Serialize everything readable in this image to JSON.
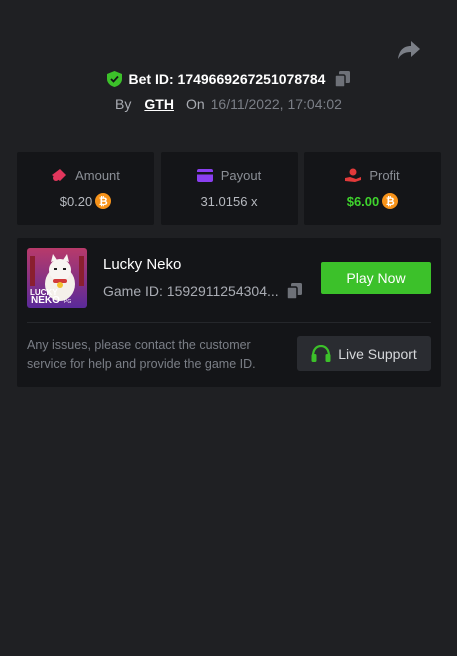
{
  "bet": {
    "id_label": "Bet ID: 1749669267251078784",
    "by_label": "By",
    "user": "GTH",
    "on_label": "On",
    "datetime": "16/11/2022, 17:04:02"
  },
  "stats": {
    "amount": {
      "label": "Amount",
      "value": "$0.20",
      "icon": "amount-icon",
      "coin": "bitcoin-icon"
    },
    "payout": {
      "label": "Payout",
      "value": "31.0156 x",
      "icon": "card-icon"
    },
    "profit": {
      "label": "Profit",
      "value": "$6.00",
      "icon": "hand-coin-icon",
      "coin": "bitcoin-icon"
    }
  },
  "game": {
    "title": "Lucky Neko",
    "id_label": "Game ID: 1592911254304...",
    "thumb_text_1": "LUCKY",
    "thumb_text_2": "NEKO",
    "thumb_text_3": "PG"
  },
  "actions": {
    "play_label": "Play Now",
    "support_label": "Live Support"
  },
  "notice": "Any issues, please contact the customer service for help and provide the game ID.",
  "colors": {
    "background": "#1f2023",
    "panel": "#141518",
    "accent_green": "#3cc12a",
    "profit_green": "#3fd32d",
    "coin": "#f7931a",
    "amount_icon": "#e2365c",
    "payout_icon": "#8a3ff0",
    "profit_icon": "#e23a3a"
  }
}
